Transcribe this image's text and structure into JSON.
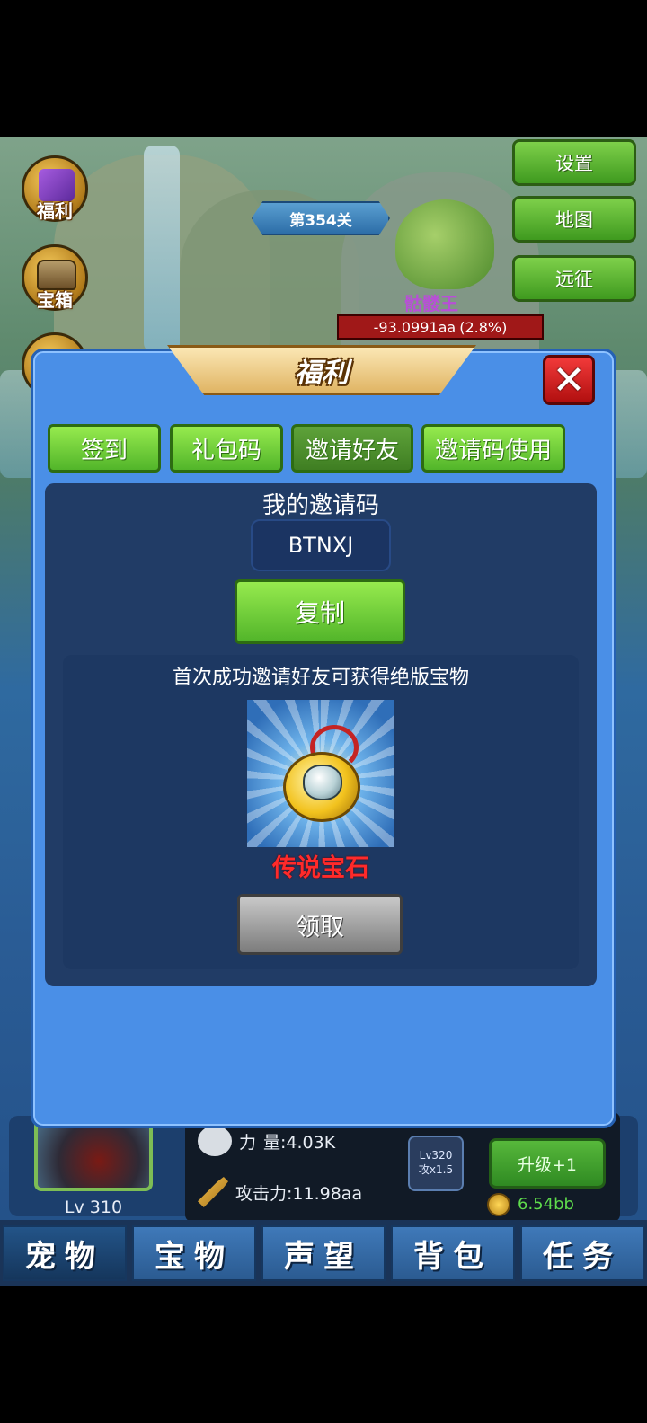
{
  "hud": {
    "left_icons": [
      {
        "label": "福利",
        "icon": "gift-chest-icon"
      },
      {
        "label": "宝箱",
        "icon": "treasure-chest-icon"
      }
    ],
    "stage": "第354关",
    "right_buttons": [
      "设置",
      "地图",
      "远征"
    ],
    "boss_name": "骷髅王",
    "boss_hp": "-93.0991aa",
    "boss_hp_percent": "(2.8%)"
  },
  "modal": {
    "title": "福利",
    "close_icon": "close-x-icon",
    "tabs": [
      {
        "label": "签到",
        "active": false
      },
      {
        "label": "礼包码",
        "active": false
      },
      {
        "label": "邀请好友",
        "active": true
      },
      {
        "label": "邀请码使用",
        "active": false
      }
    ],
    "invite": {
      "title": "我的邀请码",
      "code": "BTNXJ",
      "copy_label": "复制"
    },
    "reward": {
      "description": "首次成功邀请好友可获得绝版宝物",
      "item_icon": "legendary-gem-pendant-icon",
      "item_name": "传说宝石",
      "claim_label": "领取"
    }
  },
  "pet": {
    "level": "Lv 310",
    "power_label": "力",
    "power_value": "量:4.03K",
    "attack": "攻击力:11.98aa",
    "badge_line1": "Lv320",
    "badge_line2": "攻x1.5",
    "upgrade_label": "升级+1",
    "cost": "6.54bb"
  },
  "bottom_tabs": [
    "宠物",
    "宝物",
    "声望",
    "背包",
    "任务"
  ],
  "colors": {
    "modal_bg": "#4a8fe7",
    "green_button": "#52b52a",
    "red_text": "#ff2a2a",
    "close_red": "#d11a1a"
  }
}
